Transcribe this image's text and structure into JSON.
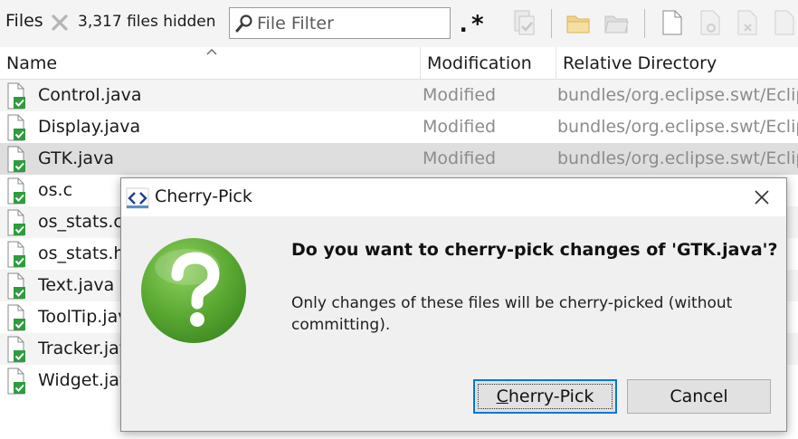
{
  "toolbar": {
    "title": "Files",
    "hidden_count": "3,317 files hidden",
    "filter_placeholder": "File Filter",
    "regex_label": ".*"
  },
  "table": {
    "columns": [
      "Name",
      "Modification",
      "Relative Directory"
    ],
    "rows": [
      {
        "name": "Control.java",
        "modification": "Modified",
        "directory": "bundles/org.eclipse.swt/Eclip"
      },
      {
        "name": "Display.java",
        "modification": "Modified",
        "directory": "bundles/org.eclipse.swt/Eclip"
      },
      {
        "name": "GTK.java",
        "modification": "Modified",
        "directory": "bundles/org.eclipse.swt/Eclip"
      },
      {
        "name": "os.c",
        "modification": "",
        "directory": ""
      },
      {
        "name": "os_stats.c",
        "modification": "",
        "directory": ""
      },
      {
        "name": "os_stats.h",
        "modification": "",
        "directory": ""
      },
      {
        "name": "Text.java",
        "modification": "",
        "directory": ""
      },
      {
        "name": "ToolTip.java",
        "modification": "",
        "directory": ""
      },
      {
        "name": "Tracker.java",
        "modification": "",
        "directory": ""
      },
      {
        "name": "Widget.java",
        "modification": "",
        "directory": ""
      }
    ]
  },
  "dialog": {
    "title": "Cherry-Pick",
    "heading": "Do you want to cherry-pick changes of 'GTK.java'?",
    "body": "Only changes of these files will be cherry-picked (without committing).",
    "primary_accel": "C",
    "primary_rest": "herry-Pick",
    "cancel_label": "Cancel"
  },
  "colors": {
    "selection": "#dedede",
    "alt_row": "#f4f4f4",
    "focus_border": "#0078d7",
    "question_green": "#5aa832",
    "file_badge_green": "#2e9c3c"
  }
}
